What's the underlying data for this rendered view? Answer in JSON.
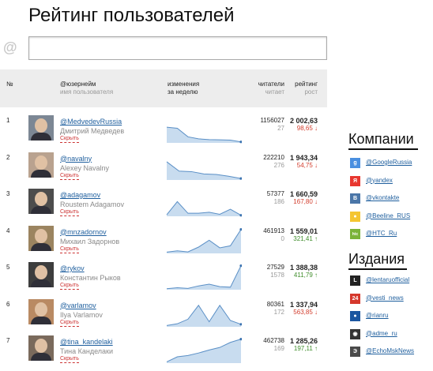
{
  "page": {
    "title": "Рейтинг пользователей"
  },
  "search": {
    "value": "",
    "at_symbol": "@"
  },
  "table_header": {
    "num": "№",
    "user": "@юзернейм",
    "user_sub": "имя пользователя",
    "change": "изменения",
    "change_sub": "за неделю",
    "readers": "читатели",
    "readers_sub": "читает",
    "rating": "рейтинг",
    "rating_sub": "рост"
  },
  "users": [
    {
      "num": "1",
      "handle": "@MedvedevRussia",
      "name": "Дмитрий Медведев",
      "hide": "Скрыть",
      "readers": "1156027",
      "reads": "27",
      "rating": "2 002,63",
      "change": "98,65 ↓",
      "trend": "down",
      "avatar_color": "#7c8794",
      "spark": [
        0.62,
        0.58,
        0.24,
        0.16,
        0.13,
        0.12,
        0.11,
        0.04
      ]
    },
    {
      "num": "2",
      "handle": "@navalny",
      "name": "Alexey Navalny",
      "hide": "Скрыть",
      "readers": "222210",
      "reads": "276",
      "rating": "1 943,34",
      "change": "54,75 ↓",
      "trend": "down",
      "avatar_color": "#b9a28f",
      "spark": [
        0.72,
        0.35,
        0.33,
        0.24,
        0.22,
        0.15,
        0.06
      ]
    },
    {
      "num": "3",
      "handle": "@adagamov",
      "name": "Roustem Adagamov",
      "hide": "Скрыть",
      "readers": "57377",
      "reads": "186",
      "rating": "1 660,59",
      "change": "167,80 ↓",
      "trend": "down",
      "avatar_color": "#4d4d4d",
      "spark": [
        0.06,
        0.58,
        0.12,
        0.12,
        0.16,
        0.08,
        0.28,
        0.04
      ]
    },
    {
      "num": "4",
      "handle": "@mnzadornov",
      "name": "Михаил Задорнов",
      "hide": "Скрыть",
      "readers": "461913",
      "reads": "0",
      "rating": "1 559,01",
      "change": "321,41 ↑",
      "trend": "up",
      "avatar_color": "#9b8460",
      "spark": [
        0.05,
        0.1,
        0.06,
        0.25,
        0.52,
        0.22,
        0.3,
        0.95
      ]
    },
    {
      "num": "5",
      "handle": "@rykov",
      "name": "Константин Рыков",
      "hide": "Скрыть",
      "readers": "27529",
      "reads": "1578",
      "rating": "1 388,38",
      "change": "411,79 ↑",
      "trend": "up",
      "avatar_color": "#3d3d3d",
      "spark": [
        0.04,
        0.08,
        0.05,
        0.15,
        0.22,
        0.12,
        0.1,
        0.95
      ]
    },
    {
      "num": "6",
      "handle": "@varlamov",
      "name": "Ilya Varlamov",
      "hide": "Скрыть",
      "readers": "80361",
      "reads": "172",
      "rating": "1 337,94",
      "change": "563,85 ↓",
      "trend": "down",
      "avatar_color": "#b98a63",
      "spark": [
        0.05,
        0.12,
        0.3,
        0.85,
        0.2,
        0.85,
        0.25,
        0.1
      ]
    },
    {
      "num": "7",
      "handle": "@tina_kandelaki",
      "name": "Тина Канделаки",
      "hide": "Скрыть",
      "readers": "462738",
      "reads": "169",
      "rating": "1 285,26",
      "change": "197,11 ↑",
      "trend": "up",
      "avatar_color": "#7a6a5c",
      "spark": [
        0.05,
        0.25,
        0.3,
        0.4,
        0.52,
        0.62,
        0.82,
        0.95
      ]
    }
  ],
  "companies": {
    "title": "Компании",
    "items": [
      {
        "name": "@GoogleRussia",
        "icon": "google-icon",
        "glyph": "g",
        "color": "#4a8fe0"
      },
      {
        "name": "@yandex",
        "icon": "yandex-icon",
        "glyph": "Я",
        "color": "#e8362f"
      },
      {
        "name": "@vkontakte",
        "icon": "vkontakte-icon",
        "glyph": "В",
        "color": "#4a76a8"
      },
      {
        "name": "@Beeline_RUS",
        "icon": "beeline-icon",
        "glyph": "●",
        "color": "#f4c531"
      },
      {
        "name": "@HTC_Ru",
        "icon": "htc-icon",
        "glyph": "htc",
        "color": "#7bb33a"
      }
    ]
  },
  "media": {
    "title": "Издания",
    "items": [
      {
        "name": "@lentaruofficial",
        "icon": "lenta-icon",
        "glyph": "L",
        "color": "#222222"
      },
      {
        "name": "@vesti_news",
        "icon": "vesti-icon",
        "glyph": "24",
        "color": "#d5382c"
      },
      {
        "name": "@rianru",
        "icon": "rian-icon",
        "glyph": "●",
        "color": "#1b56a0"
      },
      {
        "name": "@adme_ru",
        "icon": "adme-icon",
        "glyph": "◉",
        "color": "#333333"
      },
      {
        "name": "@EchoMskNews",
        "icon": "echo-icon",
        "glyph": "Э",
        "color": "#4a4a4a"
      }
    ]
  }
}
